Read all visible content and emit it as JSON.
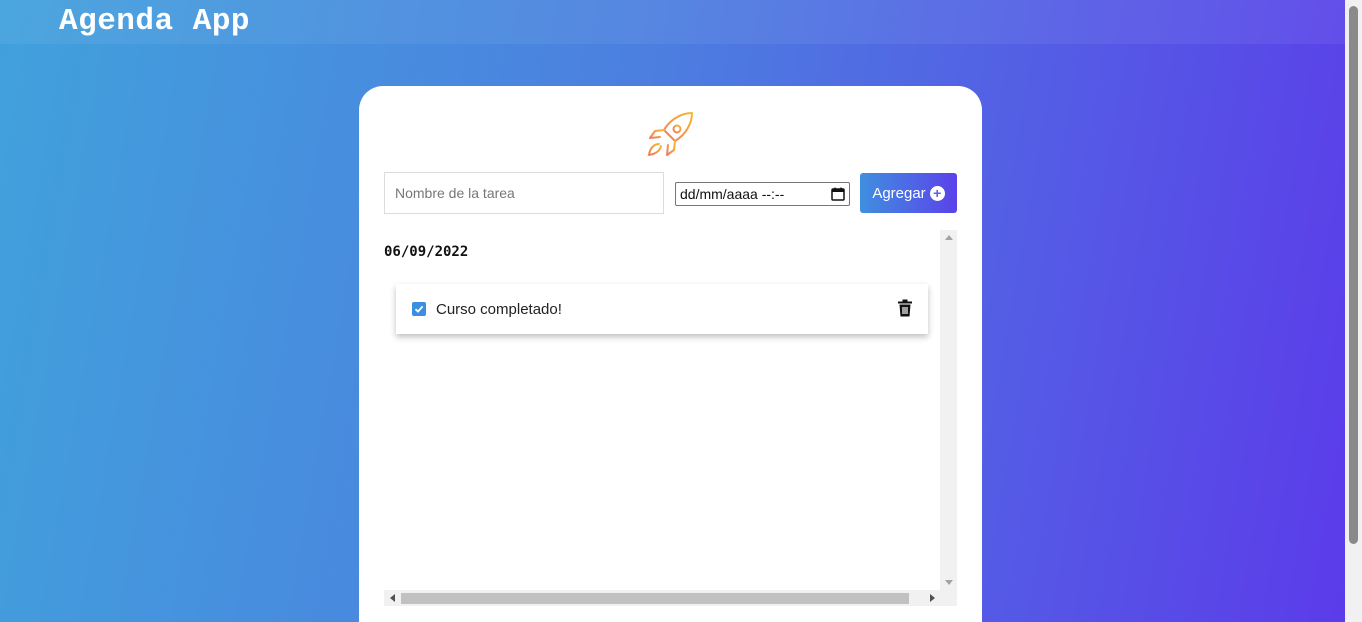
{
  "header": {
    "title": "Agenda App"
  },
  "form": {
    "task_placeholder": "Nombre de la tarea",
    "date_placeholder": "dd/mm/aaaa --:--",
    "add_label": "Agregar",
    "add_icon": "plus-circle-icon"
  },
  "tasks": {
    "groups": [
      {
        "date": "06/09/2022",
        "items": [
          {
            "text": "Curso completado!",
            "completed": true
          }
        ]
      }
    ]
  },
  "colors": {
    "accent": "#3b8fe0",
    "gradient_start": "#41a1dc",
    "gradient_end": "#5c3aea",
    "rocket_stroke": "#f5a23c"
  },
  "icons": {
    "logo": "rocket-icon",
    "delete": "trash-icon",
    "calendar": "calendar-icon"
  }
}
